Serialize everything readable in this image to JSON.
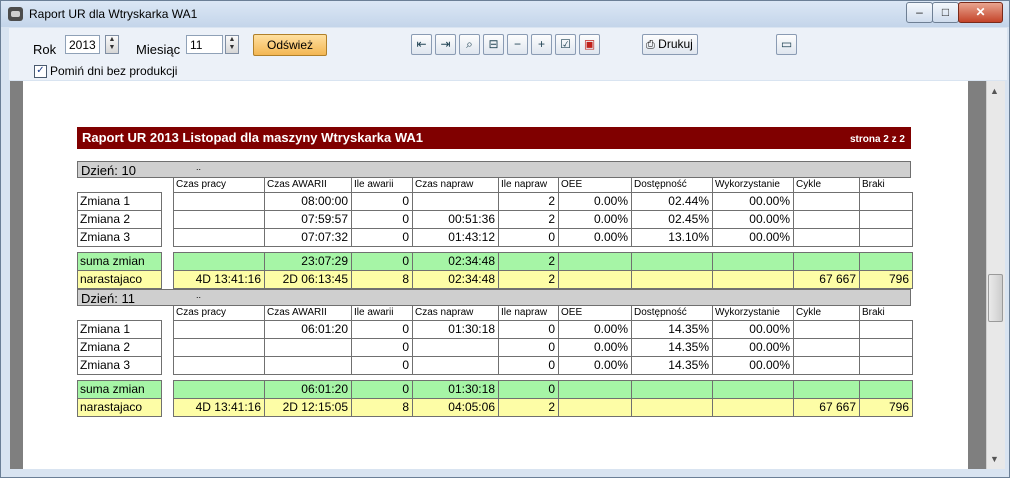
{
  "window": {
    "title": "Raport UR dla  Wtryskarka WA1",
    "min_symbol": "–",
    "max_symbol": "□",
    "close_symbol": "✕"
  },
  "controls": {
    "rok_label": "Rok",
    "rok_value": "2013",
    "miesiac_label": "Miesiąc",
    "miesiac_value": "11",
    "refresh_label": "Odśwież",
    "skip_days_label": "Pomiń dni bez produkcji",
    "skip_days_checked": true,
    "print_label": "Drukuj"
  },
  "toolbar_icons": [
    "first-page-icon",
    "last-page-icon",
    "zoom-page-icon",
    "zoom-width-icon",
    "zoom-out-icon",
    "zoom-in-icon",
    "export-excel-icon",
    "export-pdf-icon",
    "printer-icon"
  ],
  "report": {
    "title": "Raport UR  2013 Listopad  dla maszyny Wtryskarka WA1",
    "page": "strona 2 z 2",
    "columns": [
      "Czas pracy",
      "Czas AWARII",
      "Ile awarii",
      "Czas napraw",
      "Ile napraw",
      "OEE",
      "Dostępność",
      "Wykorzystanie",
      "Cykle",
      "Braki"
    ],
    "days": [
      {
        "label": "Dzień:  10",
        "dots": "..",
        "rows": [
          {
            "name": "Zmiana 1",
            "cells": [
              "",
              "08:00:00",
              "0",
              "",
              "2",
              "0.00%",
              "02.44%",
              "00.00%",
              "",
              ""
            ]
          },
          {
            "name": "Zmiana 2",
            "cells": [
              "",
              "07:59:57",
              "0",
              "00:51:36",
              "2",
              "0.00%",
              "02.45%",
              "00.00%",
              "",
              ""
            ]
          },
          {
            "name": "Zmiana 3",
            "cells": [
              "",
              "07:07:32",
              "0",
              "01:43:12",
              "0",
              "0.00%",
              "13.10%",
              "00.00%",
              "",
              ""
            ]
          }
        ],
        "suma": {
          "name": "suma zmian",
          "cells": [
            "",
            "23:07:29",
            "0",
            "02:34:48",
            "2",
            "",
            "",
            "",
            "",
            ""
          ]
        },
        "narast": {
          "name": "narastajaco",
          "cells": [
            "4D 13:41:16",
            "2D 06:13:45",
            "8",
            "02:34:48",
            "2",
            "",
            "",
            "",
            "67 667",
            "796"
          ]
        }
      },
      {
        "label": "Dzień:  11",
        "dots": "..",
        "rows": [
          {
            "name": "Zmiana 1",
            "cells": [
              "",
              "06:01:20",
              "0",
              "01:30:18",
              "0",
              "0.00%",
              "14.35%",
              "00.00%",
              "",
              ""
            ]
          },
          {
            "name": "Zmiana 2",
            "cells": [
              "",
              "",
              "0",
              "",
              "0",
              "0.00%",
              "14.35%",
              "00.00%",
              "",
              ""
            ]
          },
          {
            "name": "Zmiana 3",
            "cells": [
              "",
              "",
              "0",
              "",
              "0",
              "0.00%",
              "14.35%",
              "00.00%",
              "",
              ""
            ]
          }
        ],
        "suma": {
          "name": "suma zmian",
          "cells": [
            "",
            "06:01:20",
            "0",
            "01:30:18",
            "0",
            "",
            "",
            "",
            "",
            ""
          ]
        },
        "narast": {
          "name": "narastajaco",
          "cells": [
            "4D 13:41:16",
            "2D 12:15:05",
            "8",
            "04:05:06",
            "2",
            "",
            "",
            "",
            "67 667",
            "796"
          ]
        }
      }
    ]
  }
}
